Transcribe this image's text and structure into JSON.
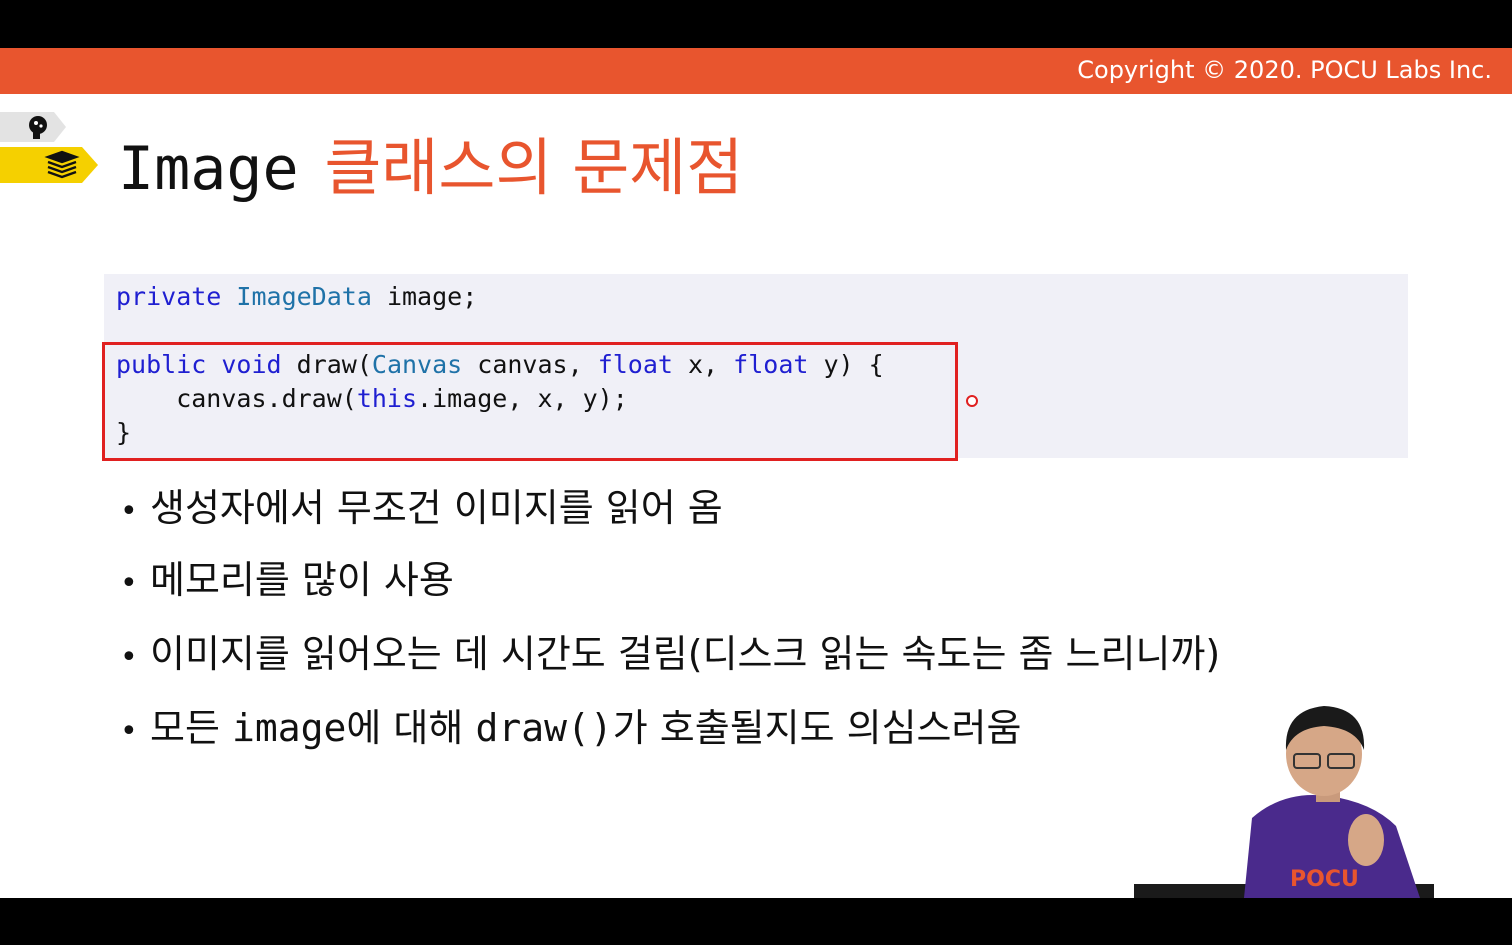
{
  "header": {
    "copyright": "Copyright © 2020. POCU Labs Inc."
  },
  "side_tabs": {
    "top_icon": "brain-head-icon",
    "bottom_icon": "stacked-books-icon"
  },
  "title": {
    "mono_part": "Image",
    "korean_part": "클래스의 문제점"
  },
  "code": {
    "line1": {
      "kw": "private",
      "type": "ImageData",
      "rest": " image;"
    },
    "line2": {
      "kw1": "public",
      "kw2": "void",
      "mid": " draw(",
      "type": "Canvas",
      "mid2": " canvas, ",
      "kw3": "float",
      "mid3": " x, ",
      "kw4": "float",
      "rest": " y) {"
    },
    "line3": {
      "pre": "    canvas.draw(",
      "kw": "this",
      "rest": ".image, x, y);"
    },
    "line4": {
      "text": "}"
    }
  },
  "bullets": [
    {
      "text": "생성자에서 무조건 이미지를 읽어 옴"
    },
    {
      "text": "메모리를 많이 사용"
    },
    {
      "text": "이미지를 읽어오는 데 시간도 걸림(디스크 읽는 속도는 좀 느리니까)"
    },
    {
      "pre": "모든 ",
      "mono": "image",
      "mid": "에 대해 ",
      "mono2": "draw()",
      "post": "가 호출될지도 의심스러움"
    }
  ],
  "bullet_symbol": "•",
  "presenter_shirt_text": "POCU",
  "colors": {
    "accent": "#e8552e",
    "keyword": "#1f1fd1",
    "type": "#1f72a8",
    "highlight": "#e02020",
    "code_bg": "#f0f0f7"
  }
}
